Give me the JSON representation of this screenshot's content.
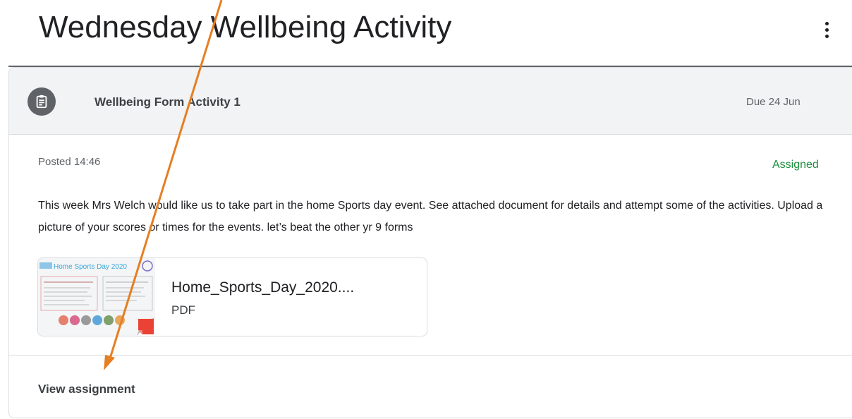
{
  "page": {
    "title": "Wednesday Wellbeing Activity",
    "more_icon": "more-vert-icon"
  },
  "card": {
    "icon": "assignment-icon",
    "title": "Wellbeing Form Activity 1",
    "due": "Due 24 Jun",
    "posted": "Posted 14:46",
    "status": "Assigned",
    "status_color": "#1e8e3e",
    "description": "This week Mrs Welch would like us to take part in the home Sports day event.  See attached document for details and attempt some of the activities.  Upload a picture of your scores or times for the events.  let’s beat the other yr 9 forms",
    "attachment": {
      "name": "Home_Sports_Day_2020....",
      "type": "PDF",
      "thumbnail_heading": "Home Sports Day 2020",
      "file_icon": "pdf-file-icon"
    },
    "view_link": "View assignment"
  },
  "annotation": {
    "shape": "arrow",
    "color": "#e67e22"
  }
}
